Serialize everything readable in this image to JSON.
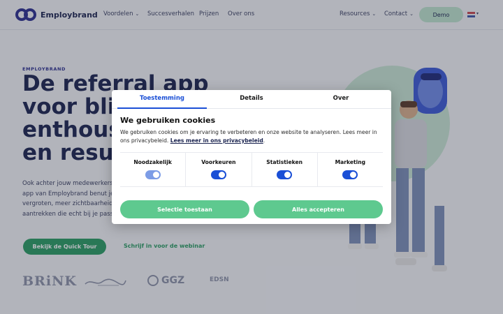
{
  "header": {
    "logo_text": "Employbrand",
    "nav": [
      {
        "label": "Voordelen",
        "dropdown": true
      },
      {
        "label": "Succesverhalen",
        "dropdown": false
      },
      {
        "label": "Prijzen",
        "dropdown": false
      },
      {
        "label": "Over ons",
        "dropdown": false
      },
      {
        "label": "Resources",
        "dropdown": true
      },
      {
        "label": "Contact",
        "dropdown": true
      }
    ],
    "demo_label": "Demo",
    "language_flag": "flag-nl-icon"
  },
  "hero": {
    "eyebrow": "EMPLOYBRAND",
    "headline_lines": [
      "De referral app",
      "voor blij",
      "enthousi",
      "en result"
    ],
    "body": "Ook achter jouw medewerkers\napp van Employbrand benut je\nvergroten, meer zichtbaarheid\naantrekken die echt bij je pass",
    "cta_primary": "Bekijk de Quick Tour",
    "cta_secondary": "Schrijf in voor de webinar",
    "partners": [
      "BRiNK",
      "GGZ",
      "EDSN"
    ]
  },
  "cookie_modal": {
    "tabs": [
      {
        "label": "Toestemming",
        "active": true
      },
      {
        "label": "Details",
        "active": false
      },
      {
        "label": "Over",
        "active": false
      }
    ],
    "title": "We gebruiken cookies",
    "text": "We gebruiken cookies om je ervaring te verbeteren en onze website te analyseren. Lees meer in ons privacybeleid.",
    "link_text": "Lees meer in ons privacybeleid",
    "categories": [
      {
        "label": "Noodzakelijk",
        "enabled": true,
        "disabled": true
      },
      {
        "label": "Voorkeuren",
        "enabled": true,
        "disabled": false
      },
      {
        "label": "Statistieken",
        "enabled": true,
        "disabled": false
      },
      {
        "label": "Marketing",
        "enabled": true,
        "disabled": false
      }
    ],
    "btn_selection": "Selectie toestaan",
    "btn_all": "Alles accepteren"
  },
  "colors": {
    "brand": "#2b2f8f",
    "accent_green": "#5ec98f",
    "toggle_blue": "#1a4fd6"
  }
}
